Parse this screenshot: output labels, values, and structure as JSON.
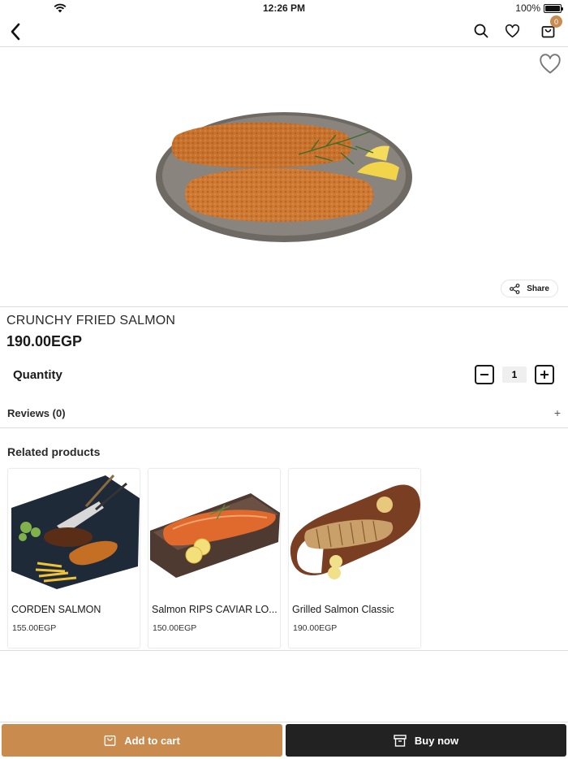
{
  "status_bar": {
    "time": "12:26 PM",
    "battery": "100%"
  },
  "nav": {
    "cart_count": "0"
  },
  "product": {
    "title": "CRUNCHY FRIED SALMON",
    "price": "190.00EGP",
    "share_label": "Share",
    "quantity_label": "Quantity",
    "quantity_value": "1",
    "reviews_label": "Reviews (0)",
    "reviews_toggle": "+"
  },
  "related": {
    "title": "Related products",
    "items": [
      {
        "name": "CORDEN SALMON",
        "price": "155.00EGP"
      },
      {
        "name": "Salmon RIPS CAVIAR LO...",
        "price": "150.00EGP"
      },
      {
        "name": "Grilled Salmon Classic",
        "price": "190.00EGP"
      }
    ]
  },
  "actions": {
    "add_to_cart": "Add to cart",
    "buy_now": "Buy now"
  },
  "colors": {
    "accent": "#c98b4e",
    "dark_button": "#222222",
    "divider": "#dcdcdc"
  }
}
